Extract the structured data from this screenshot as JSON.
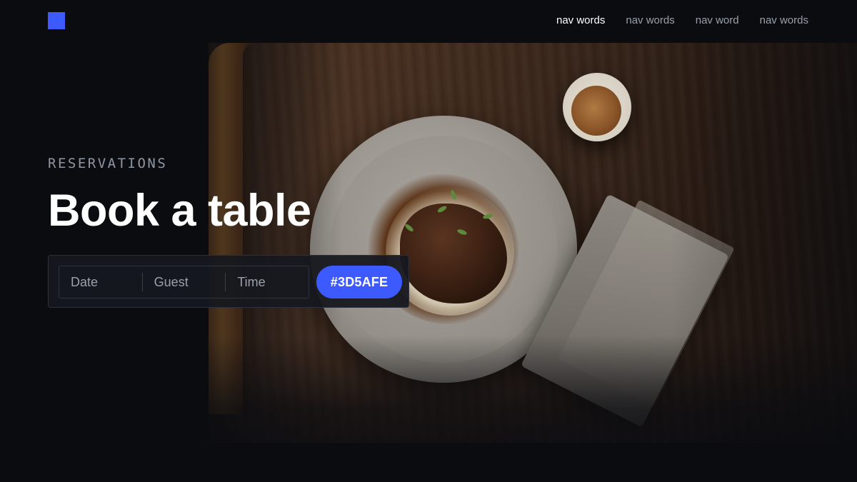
{
  "header": {
    "nav": [
      {
        "label": "nav words",
        "active": true
      },
      {
        "label": "nav words",
        "active": false
      },
      {
        "label": "nav word",
        "active": false
      },
      {
        "label": "nav words",
        "active": false
      }
    ]
  },
  "hero": {
    "eyebrow": "RESERVATIONS",
    "headline": "Book a table"
  },
  "booking": {
    "fields": {
      "date": "Date",
      "guest": "Guest",
      "time": "Time"
    },
    "submit_label": "#3D5AFE"
  },
  "colors": {
    "background": "#0b0c10",
    "accent": "#3d5afe",
    "text_primary": "#ffffff",
    "text_muted": "#9aa0ab"
  }
}
